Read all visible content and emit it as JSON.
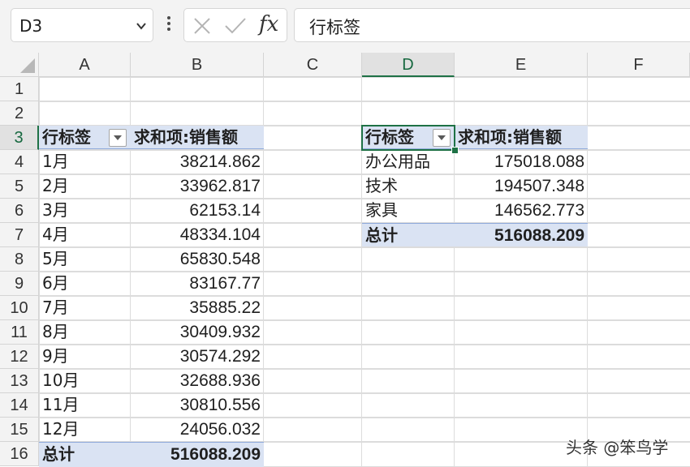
{
  "name_box": {
    "value": "D3"
  },
  "formula_bar": {
    "fx_label": "fx",
    "content": "行标签"
  },
  "columns": [
    "A",
    "B",
    "C",
    "D",
    "E",
    "F"
  ],
  "rows": [
    "1",
    "2",
    "3",
    "4",
    "5",
    "6",
    "7",
    "8",
    "9",
    "10",
    "11",
    "12",
    "13",
    "14",
    "15",
    "16"
  ],
  "pivot_left": {
    "header_label": "行标签",
    "header_value": "求和项:销售额",
    "items": [
      {
        "label": "1月",
        "value": "38214.862"
      },
      {
        "label": "2月",
        "value": "33962.817"
      },
      {
        "label": "3月",
        "value": "62153.14"
      },
      {
        "label": "4月",
        "value": "48334.104"
      },
      {
        "label": "5月",
        "value": "65830.548"
      },
      {
        "label": "6月",
        "value": "83167.77"
      },
      {
        "label": "7月",
        "value": "35885.22"
      },
      {
        "label": "8月",
        "value": "30409.932"
      },
      {
        "label": "9月",
        "value": "30574.292"
      },
      {
        "label": "10月",
        "value": "32688.936"
      },
      {
        "label": "11月",
        "value": "30810.556"
      },
      {
        "label": "12月",
        "value": "24056.032"
      }
    ],
    "total_label": "总计",
    "total_value": "516088.209"
  },
  "pivot_right": {
    "header_label": "行标签",
    "header_value": "求和项:销售额",
    "items": [
      {
        "label": "办公用品",
        "value": "175018.088"
      },
      {
        "label": "技术",
        "value": "194507.348"
      },
      {
        "label": "家具",
        "value": "146562.773"
      }
    ],
    "total_label": "总计",
    "total_value": "516088.209"
  },
  "watermark": "头条 @笨鸟学",
  "colors": {
    "selection_green": "#1e7145",
    "pivot_header_fill": "#dae3f3",
    "grid_line": "#dcdcdc",
    "header_fill": "#f3f3f3"
  },
  "icons": {
    "namebox_dropdown": "chevron-down-icon",
    "cancel": "close-icon",
    "enter": "check-icon",
    "more": "vertical-dots-icon",
    "filter": "filter-dropdown-icon",
    "select_all": "select-all-triangle-icon"
  }
}
